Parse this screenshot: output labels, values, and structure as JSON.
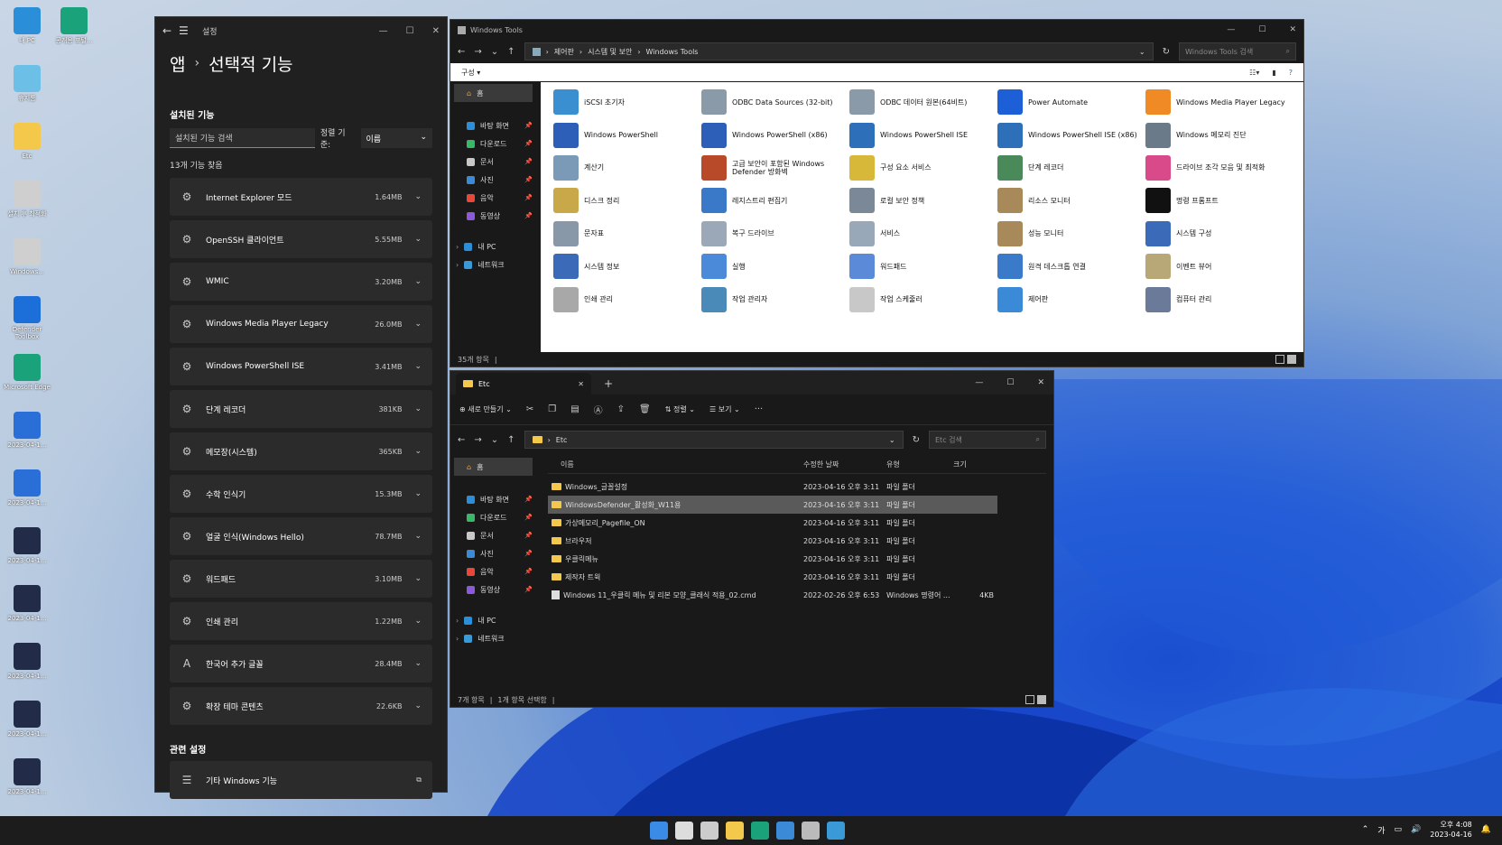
{
  "desktop": {
    "icons": [
      {
        "label": "내 PC",
        "color": "#2a8fd8"
      },
      {
        "label": "휴지통",
        "color": "#6cc0e8"
      },
      {
        "label": "Etc",
        "color": "#f4c84a"
      },
      {
        "label": "설치\n후 최적화",
        "color": "#cfcfcf"
      },
      {
        "label": "Windows...",
        "color": "#cfcfcf"
      },
      {
        "label": "Defender\nToolbox",
        "color": "#1c6fd8"
      },
      {
        "label": "Microsoft\nEdge",
        "color": "#1aa37a"
      },
      {
        "label": "2023-04-1...",
        "color": "#2a6fd8"
      },
      {
        "label": "2023-04-1...",
        "color": "#2a6fd8"
      },
      {
        "label": "2023-04-1...",
        "color": "#222c48"
      },
      {
        "label": "2023-04-1...",
        "color": "#222c48"
      },
      {
        "label": "2023-04-1...",
        "color": "#222c48"
      },
      {
        "label": "2023-04-1...",
        "color": "#222c48"
      },
      {
        "label": "2023-04-1...",
        "color": "#222c48"
      }
    ],
    "icon2": {
      "label": "공개용\n포털...",
      "color": "#1aa37a"
    }
  },
  "settings": {
    "window_title": "설정",
    "breadcrumb_parent": "앱",
    "breadcrumb_current": "선택적 기능",
    "installed_heading": "설치된 기능",
    "search_placeholder": "설치된 기능 검색",
    "sort_label": "정렬 기준:",
    "sort_value": "이름",
    "count_text": "13개 기능 찾음",
    "features": [
      {
        "name": "Internet Explorer 모드",
        "size": "1.64MB"
      },
      {
        "name": "OpenSSH 클라이언트",
        "size": "5.55MB"
      },
      {
        "name": "WMIC",
        "size": "3.20MB"
      },
      {
        "name": "Windows Media Player Legacy",
        "size": "26.0MB"
      },
      {
        "name": "Windows PowerShell ISE",
        "size": "3.41MB"
      },
      {
        "name": "단계 레코더",
        "size": "381KB"
      },
      {
        "name": "메모장(시스템)",
        "size": "365KB"
      },
      {
        "name": "수학 인식기",
        "size": "15.3MB"
      },
      {
        "name": "얼굴 인식(Windows Hello)",
        "size": "78.7MB"
      },
      {
        "name": "워드패드",
        "size": "3.10MB"
      },
      {
        "name": "인쇄 관리",
        "size": "1.22MB"
      },
      {
        "name": "한국어 추가 글꼴",
        "size": "28.4MB"
      },
      {
        "name": "확장 테마 콘텐츠",
        "size": "22.6KB"
      }
    ],
    "related_heading": "관련 설정",
    "related_item": "기타 Windows 기능"
  },
  "tools": {
    "window_title": "Windows Tools",
    "path": [
      "제어판",
      "시스템 및 보안",
      "Windows Tools"
    ],
    "search_placeholder": "Windows Tools 검색",
    "organize_label": "구성 ▾",
    "status": "35개 항목",
    "items": [
      {
        "name": "iSCSI 초기자",
        "color": "#3a8fd0"
      },
      {
        "name": "ODBC Data Sources (32-bit)",
        "color": "#8a9aa8"
      },
      {
        "name": "ODBC 데이터 원본(64비트)",
        "color": "#8a9aa8"
      },
      {
        "name": "Power Automate",
        "color": "#1d5fd6"
      },
      {
        "name": "Windows Media Player Legacy",
        "color": "#f08a24"
      },
      {
        "name": "Windows PowerShell",
        "color": "#2d5fb8"
      },
      {
        "name": "Windows PowerShell (x86)",
        "color": "#2d5fb8"
      },
      {
        "name": "Windows PowerShell ISE",
        "color": "#2d6fb8"
      },
      {
        "name": "Windows PowerShell ISE (x86)",
        "color": "#2d6fb8"
      },
      {
        "name": "Windows 메모리 진단",
        "color": "#6a7a88"
      },
      {
        "name": "계산기",
        "color": "#7a9ab8"
      },
      {
        "name": "고급 보안이 포함된 Windows Defender 방화벽",
        "color": "#b84a2a"
      },
      {
        "name": "구성 요소 서비스",
        "color": "#d8b838"
      },
      {
        "name": "단계 레코더",
        "color": "#4a8a5a"
      },
      {
        "name": "드라이브 조각 모음 및 최적화",
        "color": "#d84a8a"
      },
      {
        "name": "디스크 정리",
        "color": "#c8a848"
      },
      {
        "name": "레지스트리 편집기",
        "color": "#3a78c8"
      },
      {
        "name": "로컬 보안 정책",
        "color": "#7a8898"
      },
      {
        "name": "리소스 모니터",
        "color": "#a88a5a"
      },
      {
        "name": "명령 프롬프트",
        "color": "#111111"
      },
      {
        "name": "문자표",
        "color": "#8898a8"
      },
      {
        "name": "복구 드라이브",
        "color": "#9aa8b8"
      },
      {
        "name": "서비스",
        "color": "#98a8b8"
      },
      {
        "name": "성능 모니터",
        "color": "#a88a5a"
      },
      {
        "name": "시스템 구성",
        "color": "#3a6ab8"
      },
      {
        "name": "시스템 정보",
        "color": "#3a6ab8"
      },
      {
        "name": "실행",
        "color": "#4a8ad8"
      },
      {
        "name": "워드패드",
        "color": "#5a8ad8"
      },
      {
        "name": "원격 데스크톱 연결",
        "color": "#3a7ac8"
      },
      {
        "name": "이벤트 뷰어",
        "color": "#b8a878"
      },
      {
        "name": "인쇄 관리",
        "color": "#a8a8a8"
      },
      {
        "name": "작업 관리자",
        "color": "#4a8ab8"
      },
      {
        "name": "작업 스케줄러",
        "color": "#c8c8c8"
      },
      {
        "name": "제어판",
        "color": "#3a8ad8"
      },
      {
        "name": "컴퓨터 관리",
        "color": "#6a7a98"
      }
    ]
  },
  "nav": {
    "home": "홈",
    "quick": [
      "바탕 화면",
      "다운로드",
      "문서",
      "사진",
      "음악",
      "동영상"
    ],
    "quick_colors": [
      "#2a8fd8",
      "#3ab86a",
      "#c8c8c8",
      "#3a8ad8",
      "#e8483a",
      "#8a5ad8"
    ],
    "pc": "내 PC",
    "network": "네트워크"
  },
  "etc": {
    "tab_title": "Etc",
    "new_label": "새로 만들기",
    "sort_label": "정렬",
    "view_label": "보기",
    "path": "Etc",
    "search_placeholder": "Etc 검색",
    "columns": [
      "이름",
      "수정한 날짜",
      "유형",
      "크기"
    ],
    "files": [
      {
        "name": "Windows_글꼴설정",
        "date": "2023-04-16 오후 3:11",
        "type": "파일 폴더",
        "size": "",
        "kind": "folder"
      },
      {
        "name": "WindowsDefender_활성화_W11용",
        "date": "2023-04-16 오후 3:11",
        "type": "파일 폴더",
        "size": "",
        "kind": "folder",
        "selected": true
      },
      {
        "name": "가상메모리_Pagefile_ON",
        "date": "2023-04-16 오후 3:11",
        "type": "파일 폴더",
        "size": "",
        "kind": "folder"
      },
      {
        "name": "브라우저",
        "date": "2023-04-16 오후 3:11",
        "type": "파일 폴더",
        "size": "",
        "kind": "folder"
      },
      {
        "name": "우클릭메뉴",
        "date": "2023-04-16 오후 3:11",
        "type": "파일 폴더",
        "size": "",
        "kind": "folder"
      },
      {
        "name": "제작자 트윅",
        "date": "2023-04-16 오후 3:11",
        "type": "파일 폴더",
        "size": "",
        "kind": "folder"
      },
      {
        "name": "Windows 11_우클릭 메뉴 및 리본 모양_클래식 적용_02.cmd",
        "date": "2022-02-26 오후 6:53",
        "type": "Windows 명령어 ...",
        "size": "4KB",
        "kind": "cmd"
      }
    ],
    "status_count": "7개 항목",
    "status_selected": "1개 항목 선택함"
  },
  "taskbar": {
    "icons": [
      {
        "name": "start-icon",
        "color": "#3a8ae8"
      },
      {
        "name": "search-icon",
        "color": "#dddddd"
      },
      {
        "name": "task-view-icon",
        "color": "#cccccc"
      },
      {
        "name": "file-explorer-icon",
        "color": "#f4c84a"
      },
      {
        "name": "edge-icon",
        "color": "#1aa37a"
      },
      {
        "name": "store-icon",
        "color": "#3a8ad8"
      },
      {
        "name": "settings-icon",
        "color": "#bbbbbb"
      },
      {
        "name": "remote-desktop-icon",
        "color": "#3a9ad8"
      }
    ],
    "ime": "가",
    "time": "오후 4:08",
    "date": "2023-04-16"
  }
}
